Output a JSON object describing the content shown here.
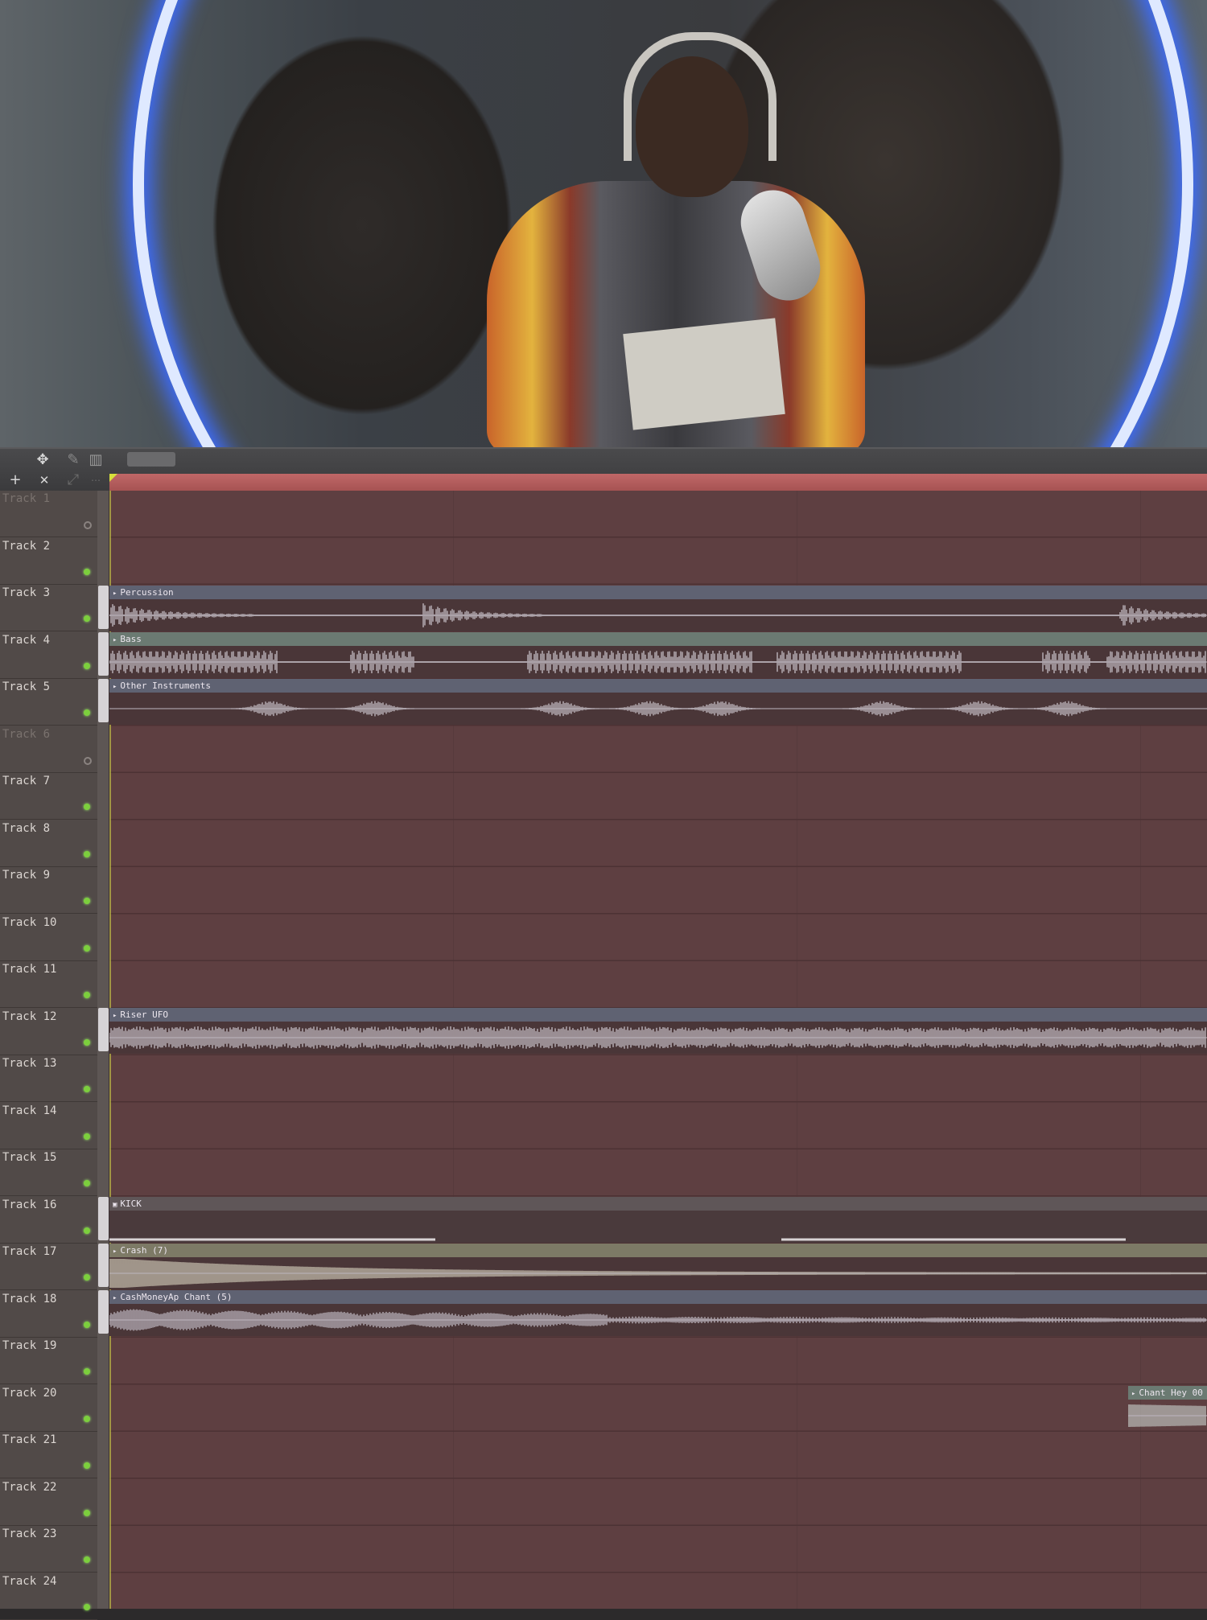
{
  "toolbar": {
    "move_icon": "✥",
    "add_icon": "+",
    "delete_icon": "✕"
  },
  "tracks": [
    {
      "name": "Track 1",
      "dim": true
    },
    {
      "name": "Track 2"
    },
    {
      "name": "Track 3"
    },
    {
      "name": "Track 4"
    },
    {
      "name": "Track 5"
    },
    {
      "name": "Track 6",
      "dim": true
    },
    {
      "name": "Track 7"
    },
    {
      "name": "Track 8"
    },
    {
      "name": "Track 9"
    },
    {
      "name": "Track 10"
    },
    {
      "name": "Track 11"
    },
    {
      "name": "Track 12"
    },
    {
      "name": "Track 13"
    },
    {
      "name": "Track 14"
    },
    {
      "name": "Track 15"
    },
    {
      "name": "Track 16"
    },
    {
      "name": "Track 17"
    },
    {
      "name": "Track 18"
    },
    {
      "name": "Track 19"
    },
    {
      "name": "Track 20"
    },
    {
      "name": "Track 21"
    },
    {
      "name": "Track 22"
    },
    {
      "name": "Track 23"
    },
    {
      "name": "Track 24"
    }
  ],
  "clips": {
    "percussion": "Percussion",
    "bass": "Bass",
    "other": "Other Instruments",
    "riser": "Riser UFO",
    "kick": "KICK",
    "crash": "Crash (7)",
    "cashmoney": "CashMoneyAp Chant (5)",
    "chant_hey": "Chant Hey 00"
  },
  "colors": {
    "timeline": "#b05a5a",
    "grid": "#5e3f41",
    "led": "#7ccf3d",
    "playhead": "#d8e03b"
  }
}
